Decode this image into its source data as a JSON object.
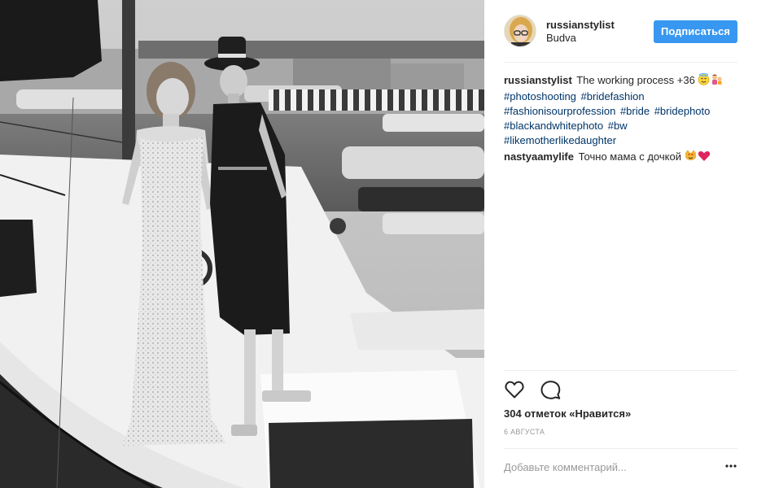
{
  "post": {
    "author": "russianstylist",
    "location": "Budva",
    "follow_label": "Подписаться"
  },
  "caption": {
    "user": "russianstylist",
    "text": "The working process +36",
    "hashtags": [
      "#photoshooting",
      "#bridefashion",
      "#fashionisourprofession",
      "#bride",
      "#bridephoto",
      "#blackandwhitephoto",
      "#bw",
      "#likemotherlikedaughter"
    ]
  },
  "comments": [
    {
      "user": "nastyaamylife",
      "text": "Точно мама с дочкой"
    }
  ],
  "likes_text": "304 отметок «Нравится»",
  "date": "6 августа",
  "add_comment_placeholder": "Добавьте комментарий...",
  "icons": {
    "like": "heart-outline-icon",
    "comment": "speech-bubble-icon",
    "more": "ellipsis-icon",
    "caption_emoji": "smiling-face-with-halo-and-family-emoji",
    "comment_emoji": "cat-face-and-red-heart-emoji"
  },
  "colors": {
    "accent": "#3897f0",
    "hashtag": "#003569",
    "muted": "#999999",
    "text": "#262626"
  }
}
